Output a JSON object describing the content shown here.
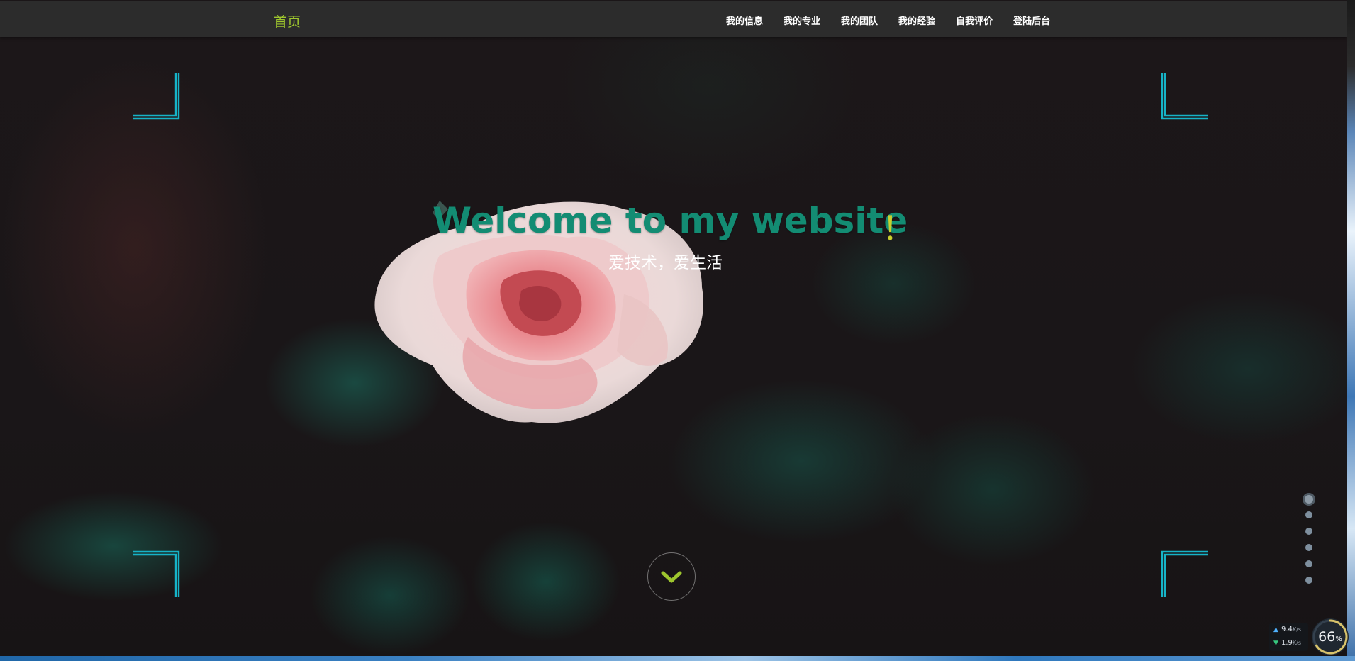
{
  "nav": {
    "brand": "首页",
    "items": [
      {
        "label": "我的信息"
      },
      {
        "label": "我的专业"
      },
      {
        "label": "我的团队"
      },
      {
        "label": "我的经验"
      },
      {
        "label": "自我评价"
      },
      {
        "label": "登陆后台"
      }
    ]
  },
  "hero": {
    "title": "Welcome to my website",
    "exclamation": "！",
    "subtitle": "爱技术，爱生活"
  },
  "pagination": {
    "total": 6,
    "active_index": 0
  },
  "network": {
    "upload": "9.4",
    "upload_unit": "K/s",
    "download": "1.9",
    "download_unit": "K/s",
    "usage": "66",
    "usage_unit": "%"
  },
  "colors": {
    "brand": "#9ec62e",
    "title": "#138c73",
    "exclamation": "#c9cf2e",
    "frame": "#16b3c7",
    "chevron": "#9ec62e"
  }
}
